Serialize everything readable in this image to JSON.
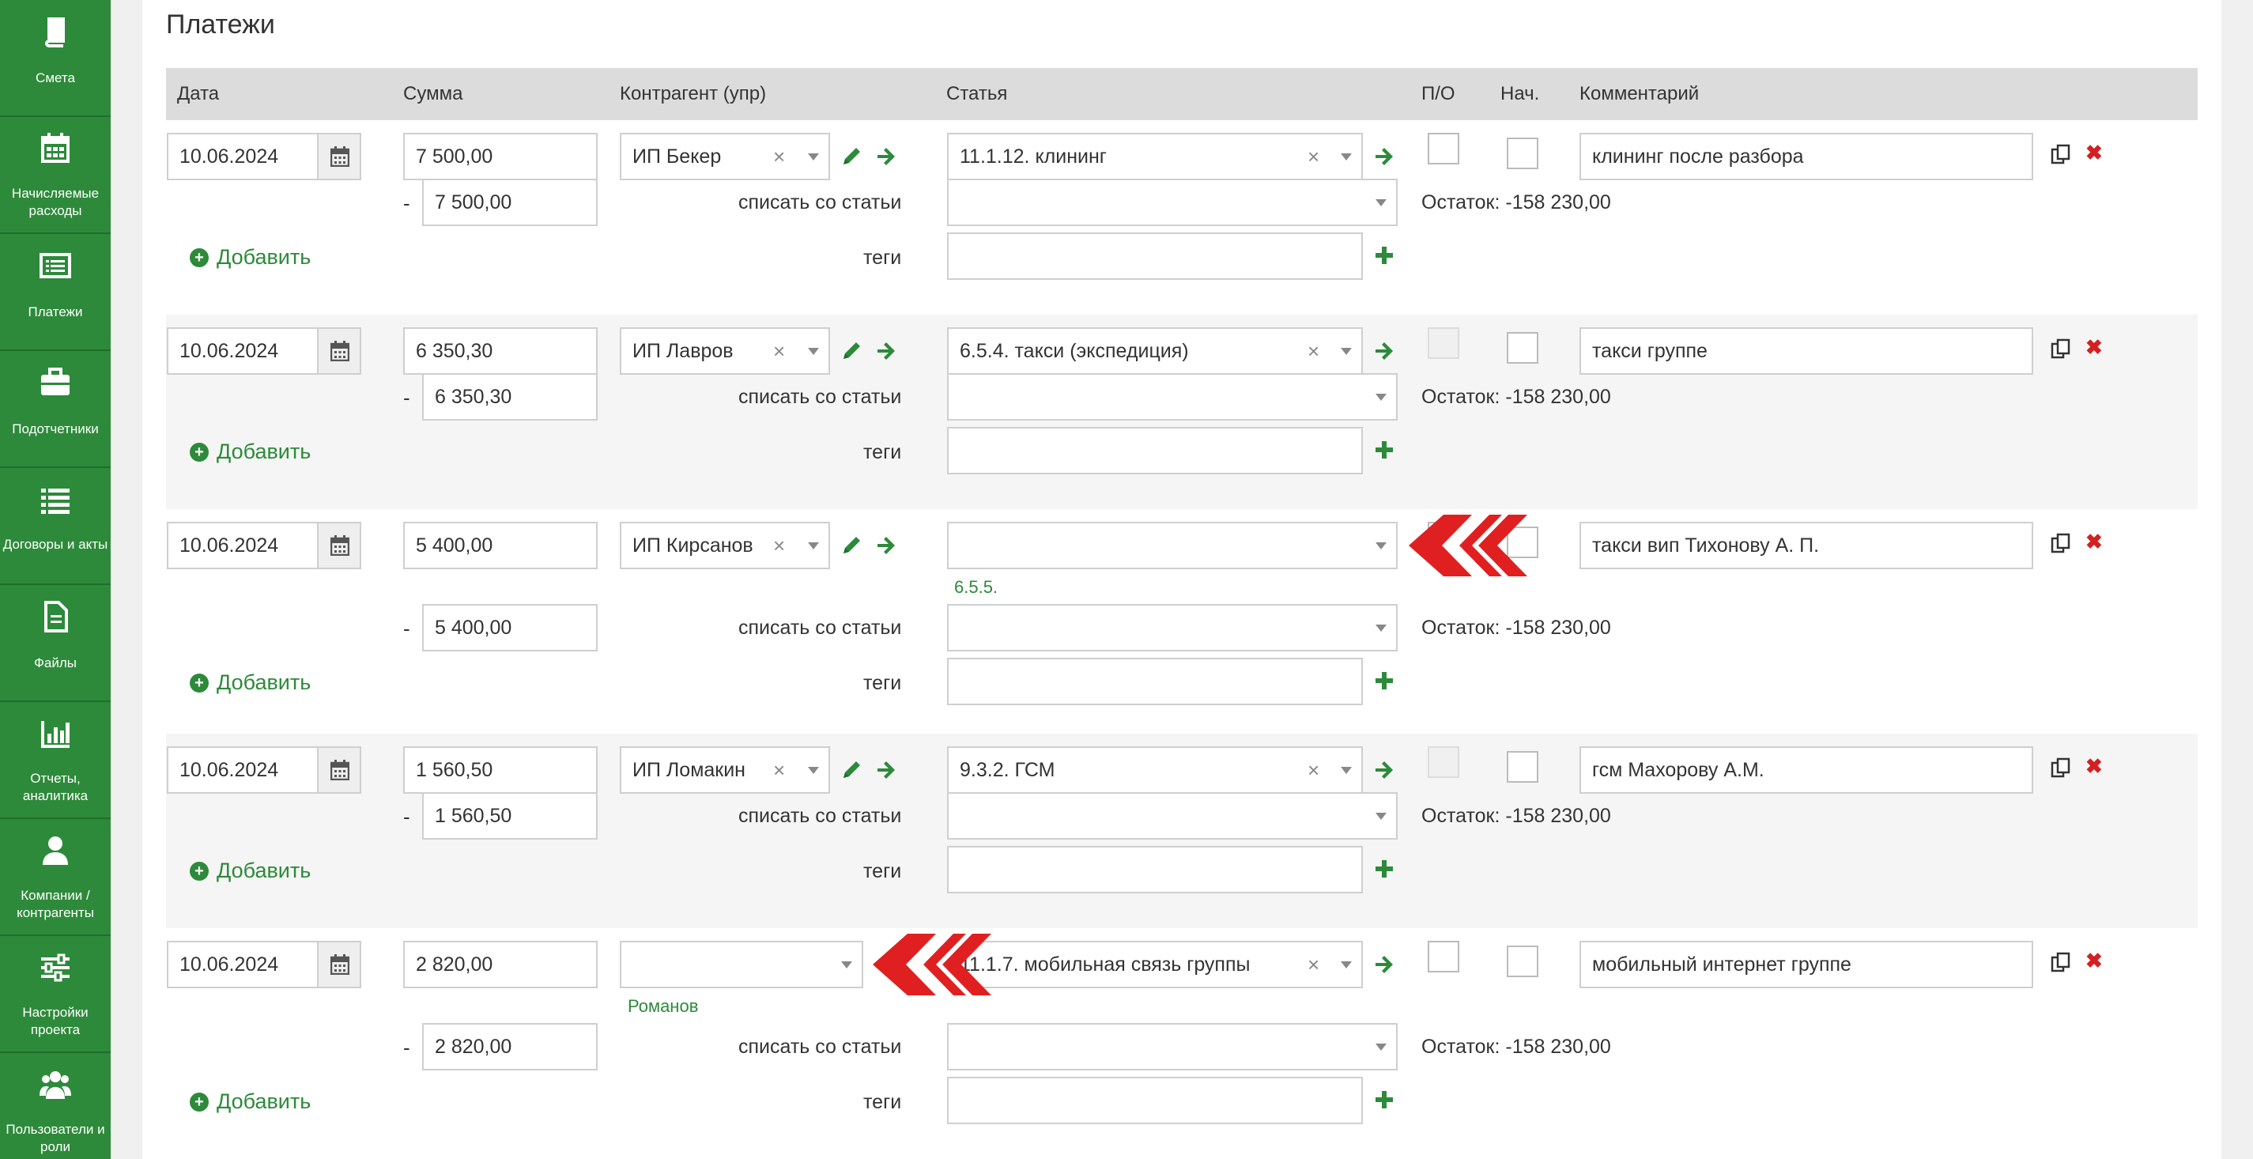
{
  "sidebar": {
    "items": [
      {
        "label": "Смета",
        "icon": "book-icon"
      },
      {
        "label": "Начисляемые расходы",
        "icon": "calendar-grid-icon"
      },
      {
        "label": "Платежи",
        "icon": "list-card-icon"
      },
      {
        "label": "Подотчетники",
        "icon": "briefcase-icon"
      },
      {
        "label": "Договоры и акты",
        "icon": "list-icon"
      },
      {
        "label": "Файлы",
        "icon": "file-icon"
      },
      {
        "label": "Отчеты, аналитика",
        "icon": "bar-chart-icon"
      },
      {
        "label": "Компании / контрагенты",
        "icon": "user-icon"
      },
      {
        "label": "Настройки проекта",
        "icon": "sliders-icon"
      },
      {
        "label": "Пользователи и роли",
        "icon": "users-icon"
      }
    ]
  },
  "page": {
    "title": "Платежи"
  },
  "columns": {
    "date": "Дата",
    "sum": "Сумма",
    "counterparty": "Контрагент (упр)",
    "article": "Статья",
    "po": "П/О",
    "nach": "Нач.",
    "comment": "Комментарий"
  },
  "labels": {
    "writeoff": "списать со статьи",
    "tags": "теги",
    "add": "Добавить",
    "minus": "-"
  },
  "payments": [
    {
      "date": "10.06.2024",
      "sum": "7 500,00",
      "counterparty": "ИП Бекер",
      "article": "11.1.12. клининг",
      "writeoff_sum": "7 500,00",
      "comment": "клининг после разбора",
      "rest": "Остаток: -158 230,00",
      "hint": ""
    },
    {
      "date": "10.06.2024",
      "sum": "6 350,30",
      "counterparty": "ИП Лавров",
      "article": "6.5.4. такси (экспедиция)",
      "writeoff_sum": "6 350,30",
      "comment": "такси группе",
      "rest": "Остаток: -158 230,00",
      "hint": ""
    },
    {
      "date": "10.06.2024",
      "sum": "5 400,00",
      "counterparty": "ИП Кирсанов",
      "article": "",
      "writeoff_sum": "5 400,00",
      "comment": "такси вип Тихонову А. П.",
      "rest": "Остаток: -158 230,00",
      "hint": "6.5.5."
    },
    {
      "date": "10.06.2024",
      "sum": "1 560,50",
      "counterparty": "ИП Ломакин",
      "article": "9.3.2. ГСМ",
      "writeoff_sum": "1 560,50",
      "comment": "гсм Махорову А.М.",
      "rest": "Остаток: -158 230,00",
      "hint": ""
    },
    {
      "date": "10.06.2024",
      "sum": "2 820,00",
      "counterparty": "",
      "article": "11.1.7. мобильная связь группы",
      "writeoff_sum": "2 820,00",
      "comment": "мобильный интернет группе",
      "rest": "Остаток: -158 230,00",
      "hint": "Романов"
    }
  ],
  "colors": {
    "brand": "#2d8a3a",
    "marker": "#e02020",
    "delete": "#d42020"
  }
}
